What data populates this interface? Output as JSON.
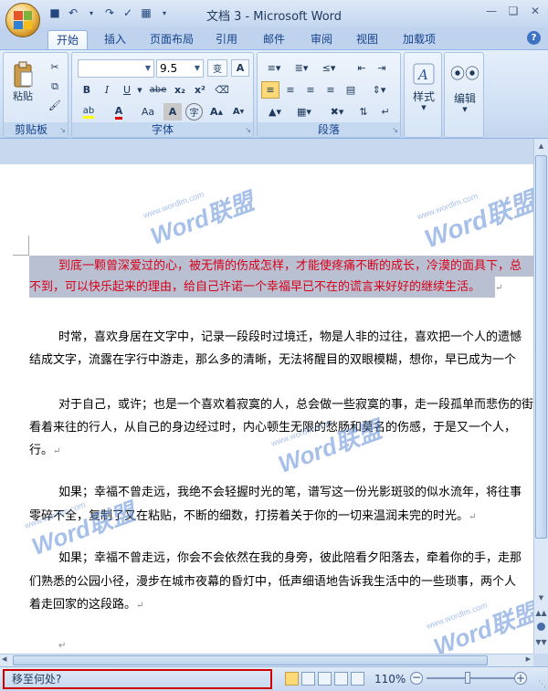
{
  "window": {
    "title": "文档 3 - Microsoft Word"
  },
  "tabs": [
    "开始",
    "插入",
    "页面布局",
    "引用",
    "邮件",
    "审阅",
    "视图",
    "加载项"
  ],
  "ribbon": {
    "clipboard": {
      "label": "剪贴板",
      "paste": "粘贴"
    },
    "font": {
      "label": "字体",
      "size": "9.5",
      "bold": "B",
      "italic": "I",
      "underline": "U",
      "strike": "abe",
      "sub": "x₂",
      "sup": "x²",
      "case": "Aa",
      "grow": "A",
      "shrink": "A"
    },
    "paragraph": {
      "label": "段落"
    },
    "styles": {
      "label": "样式"
    },
    "editing": {
      "label": "编辑"
    }
  },
  "document": {
    "p1_line1": "到底一颗曾深爱过的心，被无情的伤成怎样，才能使疼痛不断的成长，冷漠的面具下，总",
    "p1_line2": "不到，可以快乐起来的理由，给自己许诺一个幸福早已不在的谎言来好好的继续生活。",
    "p2_line1": "时常，喜欢身居在文字中，记录一段段时过境迁，物是人非的过往，喜欢把一个人的遗憾",
    "p2_line2": "结成文字，流露在字行中游走，那么多的清晰，无法将醒目的双眼模糊，想你，早已成为一个",
    "p3_line1": "对于自己，或许；也是一个喜欢着寂寞的人，总会做一些寂寞的事，走一段孤单而悲伤的街",
    "p3_line2": "看着来往的行人，从自己的身边经过时，内心顿生无限的愁肠和莫名的伤感，于是又一个人，",
    "p3_line3": "行。",
    "p4_line1": "如果；幸福不曾走远，我绝不会轻握时光的笔，谱写这一份光影斑驳的似水流年，将往事",
    "p4_line2": "零碎不全，复制了又在粘贴，不断的细数，打捞着关于你的一切来温润未完的时光。",
    "p5_line1": "如果；幸福不曾走远，你会不会依然在我的身旁，彼此陪看夕阳落去，牵着你的手，走那",
    "p5_line2": "们熟悉的公园小径，漫步在城市夜幕的昏灯中，低声细语地告诉我生活中的一些琐事，两个人",
    "p5_line3": "着走回家的这段路。"
  },
  "watermark": {
    "brand": "Word联盟",
    "url": "www.wordlm.com"
  },
  "status": {
    "prompt": "移至何处?",
    "zoom": "110%"
  },
  "colors": {
    "selection": "#b8c0d2",
    "red_text": "#d8001a",
    "status_outline": "#d00000"
  }
}
